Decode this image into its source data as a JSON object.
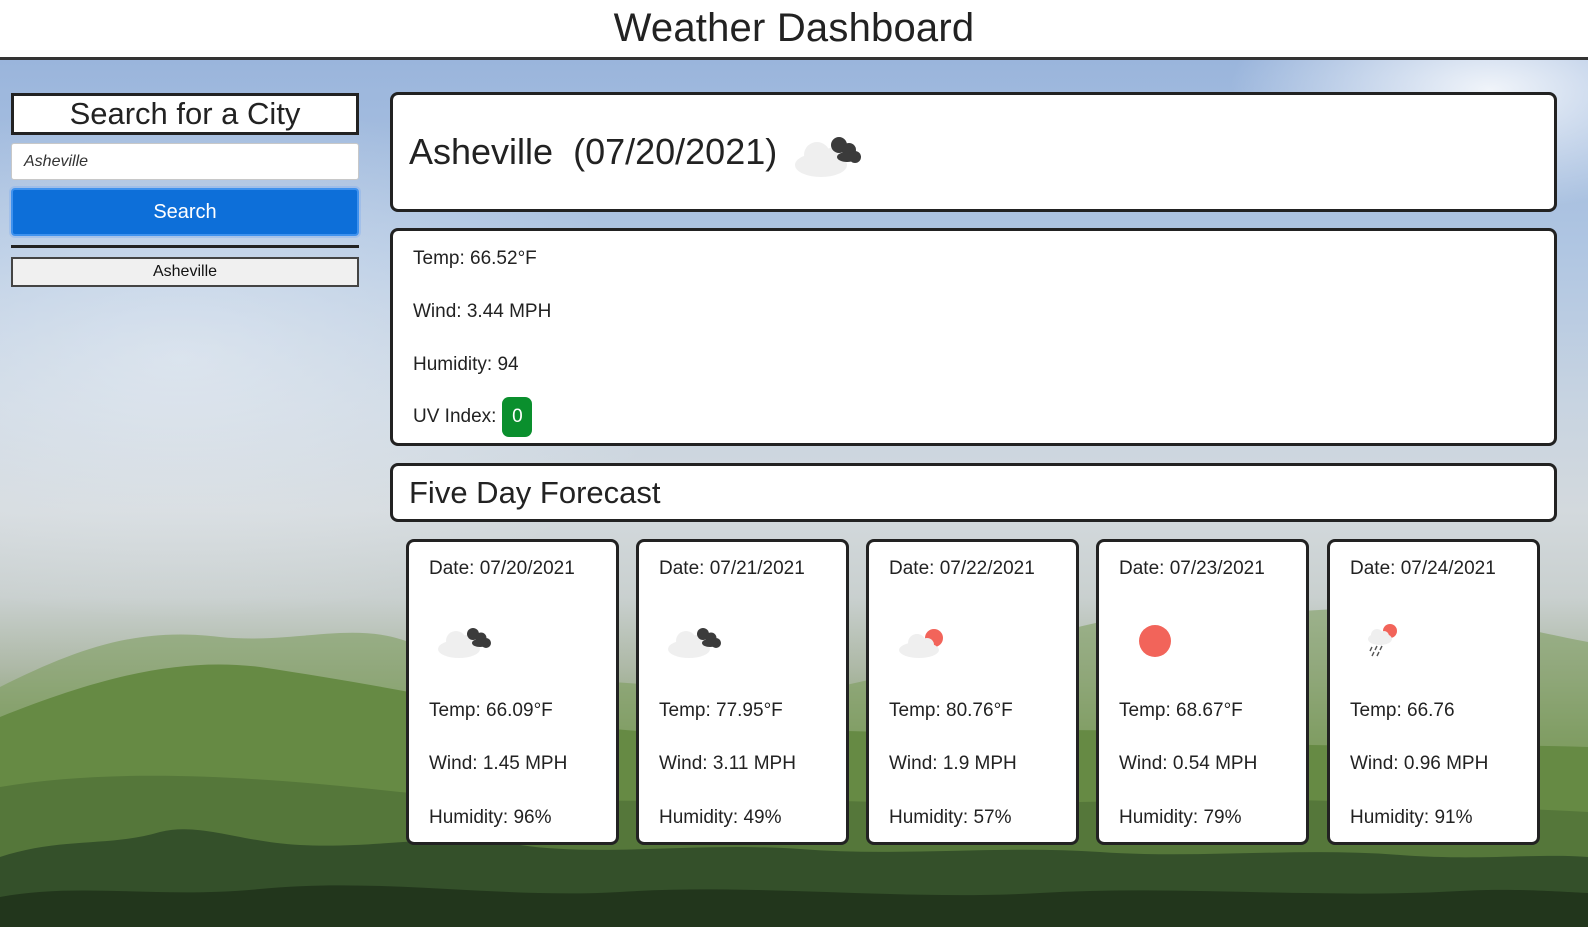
{
  "header": {
    "title": "Weather Dashboard"
  },
  "sidebar": {
    "search_title": "Search for a City",
    "search_input_value": "Asheville",
    "search_button_label": "Search",
    "history": [
      {
        "label": "Asheville"
      }
    ]
  },
  "current": {
    "title": "Asheville  (07/20/2021)",
    "icon": "broken-clouds-icon",
    "temp": "Temp: 66.52°F",
    "wind": "Wind: 3.44 MPH",
    "humidity": "Humidity: 94",
    "uv_label": "UV Index:",
    "uv_value": "0",
    "uv_color": "#0a8f2d"
  },
  "forecast": {
    "title": "Five Day Forecast",
    "days": [
      {
        "date": "Date: 07/20/2021",
        "icon": "broken-clouds-icon",
        "temp": "Temp: 66.09°F",
        "wind": "Wind: 1.45 MPH",
        "humidity": "Humidity: 96%"
      },
      {
        "date": "Date: 07/21/2021",
        "icon": "broken-clouds-icon",
        "temp": "Temp: 77.95°F",
        "wind": "Wind: 3.11 MPH",
        "humidity": "Humidity: 49%"
      },
      {
        "date": "Date: 07/22/2021",
        "icon": "few-clouds-icon",
        "temp": "Temp: 80.76°F",
        "wind": "Wind: 1.9 MPH",
        "humidity": "Humidity: 57%"
      },
      {
        "date": "Date: 07/23/2021",
        "icon": "clear-sun-icon",
        "temp": "Temp: 68.67°F",
        "wind": "Wind: 0.54 MPH",
        "humidity": "Humidity: 79%"
      },
      {
        "date": "Date: 07/24/2021",
        "icon": "rain-sun-icon",
        "temp": "Temp: 66.76",
        "wind": "Wind: 0.96 MPH",
        "humidity": "Humidity: 91%"
      }
    ]
  },
  "colors": {
    "accent": "#0d6fd9",
    "sun": "#f2645a",
    "border": "#222222"
  }
}
